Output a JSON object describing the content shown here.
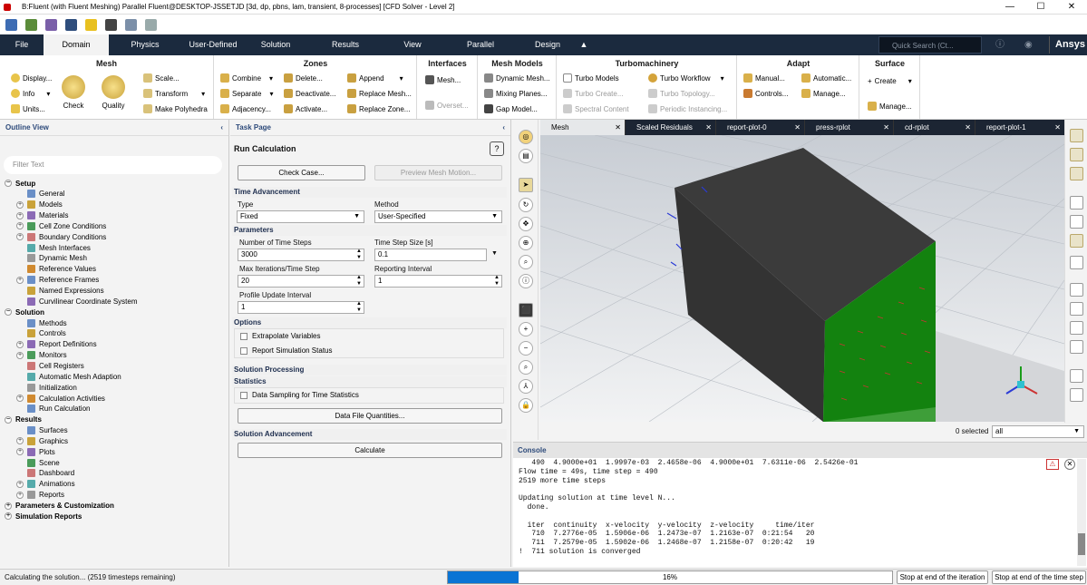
{
  "window": {
    "title": "B:Fluent (with Fluent Meshing) Parallel Fluent@DESKTOP-JSSETJD  [3d, dp, pbns, lam, transient, 8-processes] [CFD Solver - Level 2]"
  },
  "menu": {
    "items": [
      "File",
      "Domain",
      "Physics",
      "User-Defined",
      "Solution",
      "Results",
      "View",
      "Parallel",
      "Design"
    ],
    "active": "Domain",
    "search_placeholder": "Quick Search (Ct...",
    "brand": "Ansys"
  },
  "ribbon": {
    "mesh": {
      "title": "Mesh",
      "display": "Display...",
      "info": "Info",
      "units": "Units...",
      "check": "Check",
      "quality": "Quality",
      "scale": "Scale...",
      "transform": "Transform",
      "polyhedra": "Make Polyhedra"
    },
    "zones": {
      "title": "Zones",
      "combine": "Combine",
      "separate": "Separate",
      "adjacency": "Adjacency...",
      "delete": "Delete...",
      "deactivate": "Deactivate...",
      "activate": "Activate...",
      "append": "Append",
      "replace_mesh": "Replace Mesh...",
      "replace_zone": "Replace Zone..."
    },
    "interfaces": {
      "title": "Interfaces",
      "mesh": "Mesh...",
      "overset": "Overset..."
    },
    "mesh_models": {
      "title": "Mesh Models",
      "dynamic": "Dynamic Mesh...",
      "mixing": "Mixing Planes...",
      "gap": "Gap Model..."
    },
    "turbo": {
      "title": "Turbomachinery",
      "models": "Turbo Models",
      "create": "Turbo Create...",
      "spectral": "Spectral Content",
      "workflow": "Turbo Workflow",
      "topology": "Turbo Topology...",
      "periodic": "Periodic Instancing..."
    },
    "adapt": {
      "title": "Adapt",
      "manual": "Manual...",
      "controls": "Controls...",
      "automatic": "Automatic...",
      "manage": "Manage..."
    },
    "surface": {
      "title": "Surface",
      "create": "Create",
      "manage": "Manage..."
    }
  },
  "outline": {
    "title": "Outline View",
    "filter_placeholder": "Filter Text",
    "setup": {
      "label": "Setup",
      "items": [
        "General",
        "Models",
        "Materials",
        "Cell Zone Conditions",
        "Boundary Conditions",
        "Mesh Interfaces",
        "Dynamic Mesh",
        "Reference Values",
        "Reference Frames",
        "Named Expressions",
        "Curvilinear Coordinate System"
      ]
    },
    "solution": {
      "label": "Solution",
      "items": [
        "Methods",
        "Controls",
        "Report Definitions",
        "Monitors",
        "Cell Registers",
        "Automatic Mesh Adaption",
        "Initialization",
        "Calculation Activities",
        "Run Calculation"
      ]
    },
    "results": {
      "label": "Results",
      "items": [
        "Surfaces",
        "Graphics",
        "Plots",
        "Scene",
        "Dashboard",
        "Animations",
        "Reports"
      ]
    },
    "params": "Parameters & Customization",
    "sim_reports": "Simulation Reports"
  },
  "task": {
    "title": "Task Page",
    "heading": "Run Calculation",
    "check_case": "Check Case...",
    "preview": "Preview Mesh Motion...",
    "time_adv": "Time Advancement",
    "type_label": "Type",
    "type_value": "Fixed",
    "method_label": "Method",
    "method_value": "User-Specified",
    "params": "Parameters",
    "n_steps_label": "Number of Time Steps",
    "n_steps": "3000",
    "step_size_label": "Time Step Size [s]",
    "step_size": "0.1",
    "max_iter_label": "Max Iterations/Time Step",
    "max_iter": "20",
    "report_int_label": "Reporting Interval",
    "report_int": "1",
    "profile_label": "Profile Update Interval",
    "profile": "1",
    "options": "Options",
    "extrapolate": "Extrapolate Variables",
    "report_status": "Report Simulation Status",
    "sol_proc": "Solution Processing",
    "statistics": "Statistics",
    "data_sampling": "Data Sampling for Time Statistics",
    "data_file": "Data File Quantities...",
    "sol_adv": "Solution Advancement",
    "calculate": "Calculate"
  },
  "graphics_tabs": [
    "Mesh",
    "Scaled Residuals",
    "report-plot-0",
    "press-rplot",
    "cd-rplot",
    "report-plot-1"
  ],
  "selection": {
    "count": "0 selected",
    "filter": "all"
  },
  "console": {
    "title": "Console",
    "lines": [
      "   490  4.9000e+01  1.9997e-03  2.4658e-06  4.9000e+01  7.6311e-06  2.5426e-01",
      "Flow time = 49s, time step = 490",
      "2519 more time steps",
      "",
      "Updating solution at time level N...",
      "  done.",
      "",
      "  iter  continuity  x-velocity  y-velocity  z-velocity     time/iter",
      "   710  7.2776e-05  1.5906e-06  1.2473e-07  1.2163e-07  0:21:54   20",
      "   711  7.2579e-05  1.5902e-06  1.2468e-07  1.2158e-07  0:20:42   19",
      "!  711 solution is converged"
    ]
  },
  "status": {
    "text": "Calculating the solution... (2519 timesteps remaining)",
    "progress": 0.16,
    "progress_label": "16%",
    "stop_iter": "Stop at end of the iteration",
    "stop_step": "Stop at end of the time step"
  }
}
